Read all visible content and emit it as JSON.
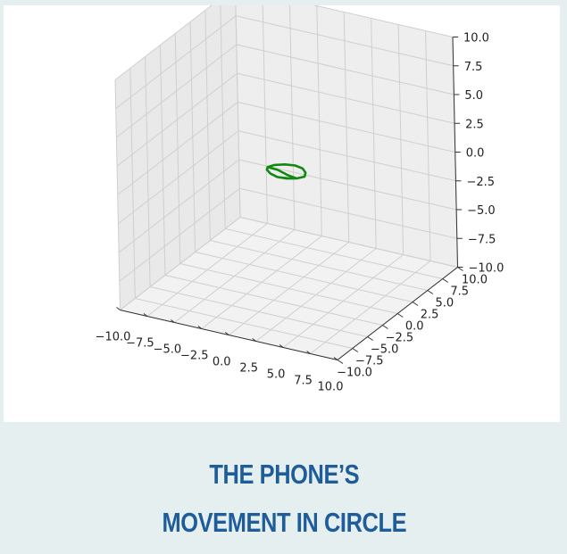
{
  "caption": {
    "line1": "THE PHONE’S",
    "line2": "MOVEMENT IN CIRCLE"
  },
  "colors": {
    "caption_text": "#1f5d9a",
    "path": "#118811",
    "pane": "#f2f2f2",
    "grid": "#cfcfcf",
    "background": "#e6efef"
  },
  "chart_data": {
    "type": "line3d",
    "title": "",
    "xlabel": "",
    "ylabel": "",
    "zlabel": "",
    "xlim": [
      -10,
      10
    ],
    "ylim": [
      -10,
      10
    ],
    "zlim": [
      -10,
      10
    ],
    "grid": true,
    "x_ticks": [
      {
        "v": -10,
        "label": "−10.0"
      },
      {
        "v": -7.5,
        "label": "−7.5"
      },
      {
        "v": -5,
        "label": "−5.0"
      },
      {
        "v": -2.5,
        "label": "−2.5"
      },
      {
        "v": 0,
        "label": "0.0"
      },
      {
        "v": 2.5,
        "label": "2.5"
      },
      {
        "v": 5,
        "label": "5.0"
      },
      {
        "v": 7.5,
        "label": "7.5"
      },
      {
        "v": 10,
        "label": "10.0"
      }
    ],
    "y_ticks": [
      {
        "v": -10,
        "label": "−10.0"
      },
      {
        "v": -7.5,
        "label": "−7.5"
      },
      {
        "v": -5,
        "label": "−5.0"
      },
      {
        "v": -2.5,
        "label": "−2.5"
      },
      {
        "v": 0,
        "label": "0.0"
      },
      {
        "v": 2.5,
        "label": "2.5"
      },
      {
        "v": 5,
        "label": "5.0"
      },
      {
        "v": 7.5,
        "label": "7.5"
      },
      {
        "v": 10,
        "label": "10.0"
      }
    ],
    "z_ticks": [
      {
        "v": -10,
        "label": "−10.0"
      },
      {
        "v": -7.5,
        "label": "−7.5"
      },
      {
        "v": -5,
        "label": "−5.0"
      },
      {
        "v": -2.5,
        "label": "−2.5"
      },
      {
        "v": 0,
        "label": "0.0"
      },
      {
        "v": 2.5,
        "label": "2.5"
      },
      {
        "v": 5,
        "label": "5.0"
      },
      {
        "v": 7.5,
        "label": "7.5"
      },
      {
        "v": 10,
        "label": "10.0"
      }
    ],
    "series": [
      {
        "color": "#118811",
        "points": [
          [
            -1.6,
            -0.2,
            0.3
          ],
          [
            -1.3,
            0.4,
            0.3
          ],
          [
            -0.6,
            0.9,
            0.3
          ],
          [
            0.2,
            1.1,
            0.3
          ],
          [
            1.0,
            0.9,
            0.3
          ],
          [
            1.6,
            0.3,
            0.3
          ],
          [
            1.9,
            -0.4,
            0.3
          ],
          [
            1.5,
            -1.0,
            0.3
          ],
          [
            0.8,
            -1.4,
            0.3
          ],
          [
            0.0,
            -1.5,
            0.3
          ],
          [
            -0.8,
            -1.2,
            0.3
          ],
          [
            -1.4,
            -0.7,
            0.3
          ],
          [
            -1.6,
            -0.2,
            0.3
          ],
          [
            -0.6,
            -0.3,
            0.3
          ],
          [
            0.6,
            -0.8,
            0.3
          ],
          [
            1.5,
            -1.0,
            0.3
          ],
          [
            0.9,
            -1.3,
            0.3
          ],
          [
            0.1,
            -1.5,
            0.3
          ]
        ]
      }
    ]
  }
}
